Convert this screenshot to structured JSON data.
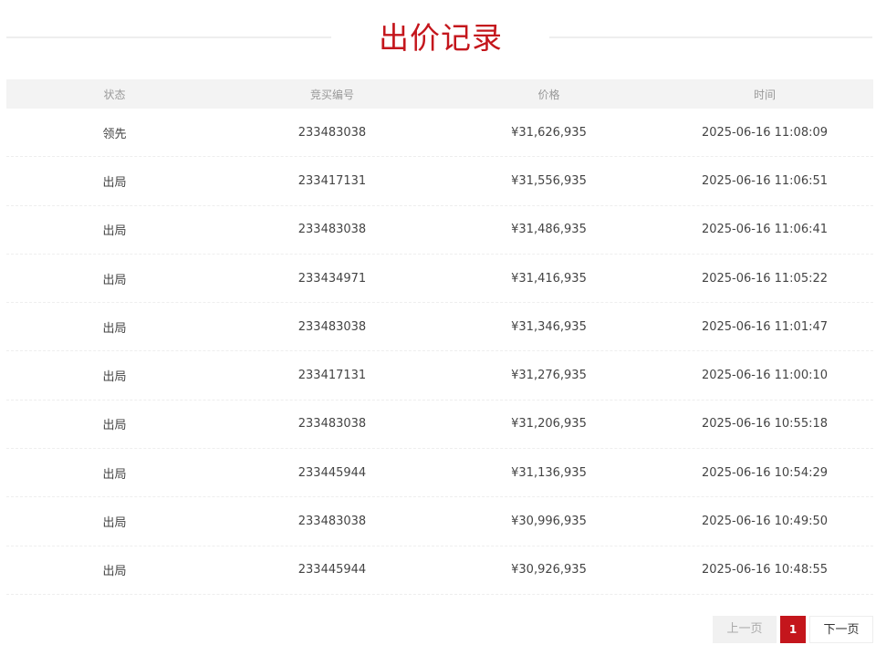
{
  "title": "出价记录",
  "table": {
    "headers": {
      "status": "状态",
      "bid_no": "竞买编号",
      "price": "价格",
      "time": "时间"
    },
    "rows": [
      {
        "status": "领先",
        "bid_no": "233483038",
        "price": "¥31,626,935",
        "time": "2025-06-16 11:08:09"
      },
      {
        "status": "出局",
        "bid_no": "233417131",
        "price": "¥31,556,935",
        "time": "2025-06-16 11:06:51"
      },
      {
        "status": "出局",
        "bid_no": "233483038",
        "price": "¥31,486,935",
        "time": "2025-06-16 11:06:41"
      },
      {
        "status": "出局",
        "bid_no": "233434971",
        "price": "¥31,416,935",
        "time": "2025-06-16 11:05:22"
      },
      {
        "status": "出局",
        "bid_no": "233483038",
        "price": "¥31,346,935",
        "time": "2025-06-16 11:01:47"
      },
      {
        "status": "出局",
        "bid_no": "233417131",
        "price": "¥31,276,935",
        "time": "2025-06-16 11:00:10"
      },
      {
        "status": "出局",
        "bid_no": "233483038",
        "price": "¥31,206,935",
        "time": "2025-06-16 10:55:18"
      },
      {
        "status": "出局",
        "bid_no": "233445944",
        "price": "¥31,136,935",
        "time": "2025-06-16 10:54:29"
      },
      {
        "status": "出局",
        "bid_no": "233483038",
        "price": "¥30,996,935",
        "time": "2025-06-16 10:49:50"
      },
      {
        "status": "出局",
        "bid_no": "233445944",
        "price": "¥30,926,935",
        "time": "2025-06-16 10:48:55"
      }
    ]
  },
  "pagination": {
    "prev_label": "上一页",
    "current_page": "1",
    "next_label": "下一页"
  },
  "colors": {
    "accent": "#c4161c",
    "header_bg": "#f3f3f3"
  }
}
